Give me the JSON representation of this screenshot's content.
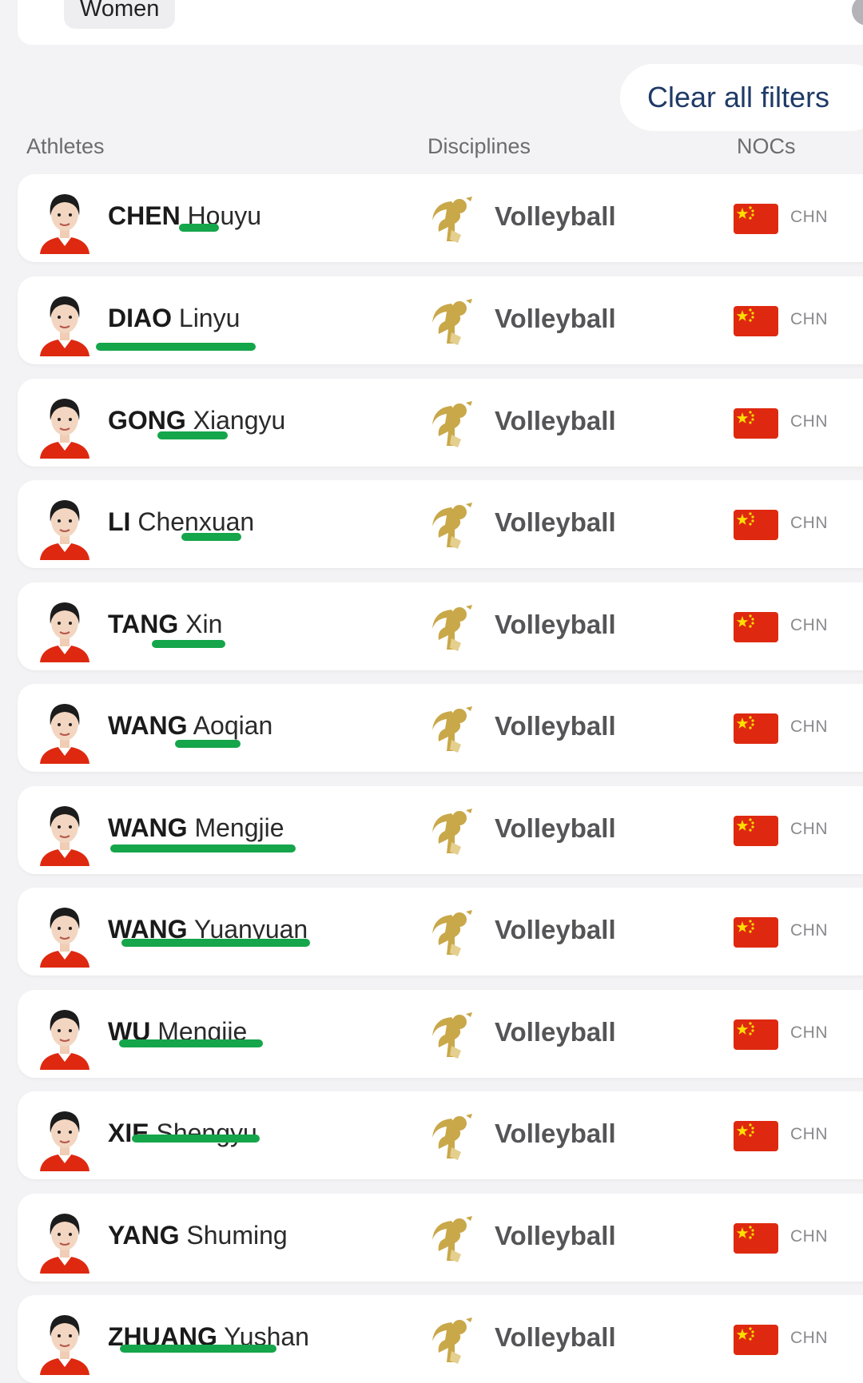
{
  "filters": {
    "gender_chip": "Women",
    "clear_all_label": "Clear all filters"
  },
  "columns": {
    "athletes": "Athletes",
    "disciplines": "Disciplines",
    "nocs": "NOCs"
  },
  "colors": {
    "underline": "#15a54a",
    "flag_red": "#de2910",
    "flag_star": "#ffde00",
    "discipline_icon": "#c9a84a"
  },
  "athletes": [
    {
      "surname": "CHEN",
      "given": "Houyu",
      "discipline": "Volleyball",
      "noc": "CHN"
    },
    {
      "surname": "DIAO",
      "given": "Linyu",
      "discipline": "Volleyball",
      "noc": "CHN"
    },
    {
      "surname": "GONG",
      "given": "Xiangyu",
      "discipline": "Volleyball",
      "noc": "CHN"
    },
    {
      "surname": "LI",
      "given": "Chenxuan",
      "discipline": "Volleyball",
      "noc": "CHN"
    },
    {
      "surname": "TANG",
      "given": "Xin",
      "discipline": "Volleyball",
      "noc": "CHN"
    },
    {
      "surname": "WANG",
      "given": "Aoqian",
      "discipline": "Volleyball",
      "noc": "CHN"
    },
    {
      "surname": "WANG",
      "given": "Mengjie",
      "discipline": "Volleyball",
      "noc": "CHN"
    },
    {
      "surname": "WANG",
      "given": "Yuanyuan",
      "discipline": "Volleyball",
      "noc": "CHN"
    },
    {
      "surname": "WU",
      "given": "Mengjie",
      "discipline": "Volleyball",
      "noc": "CHN"
    },
    {
      "surname": "XIE",
      "given": "Shengyu",
      "discipline": "Volleyball",
      "noc": "CHN"
    },
    {
      "surname": "YANG",
      "given": "Shuming",
      "discipline": "Volleyball",
      "noc": "CHN"
    },
    {
      "surname": "ZHUANG",
      "given": "Yushan",
      "discipline": "Volleyball",
      "noc": "CHN"
    }
  ]
}
